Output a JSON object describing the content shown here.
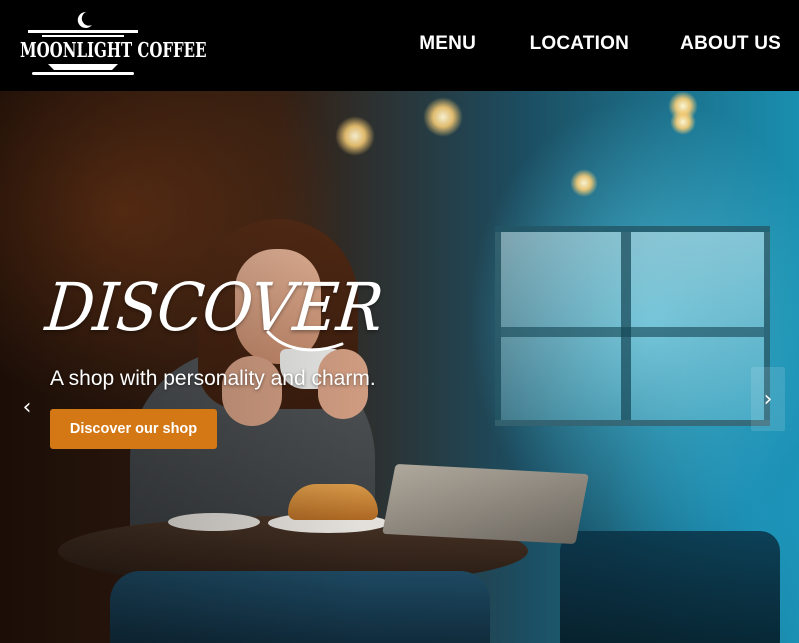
{
  "brand": {
    "name": "MOONLIGHT COFFEE",
    "logo_icon": "crescent-moon-cup-icon"
  },
  "nav": {
    "items": [
      {
        "label": "MENU"
      },
      {
        "label": "LOCATION"
      },
      {
        "label": "ABOUT US"
      }
    ]
  },
  "hero": {
    "title": "DISCOVER",
    "subtitle": "A shop with personality and charm.",
    "cta_label": "Discover our shop",
    "prev_glyph": "‹",
    "next_glyph": "›",
    "image_subject": "woman-drinking-coffee-in-cafe"
  },
  "colors": {
    "header_bg": "#000000",
    "accent": "#d47816",
    "text": "#ffffff"
  }
}
